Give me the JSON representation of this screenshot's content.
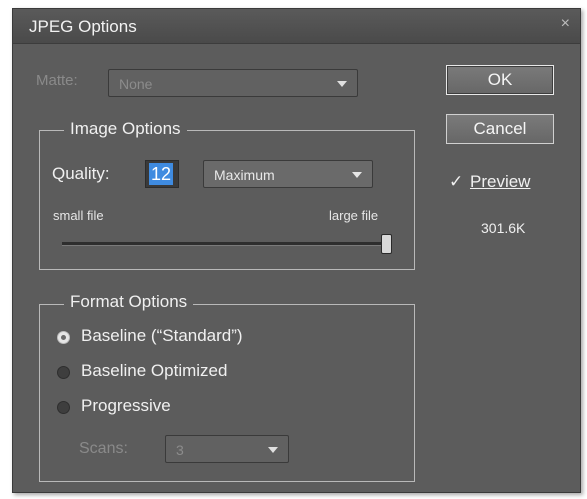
{
  "dialog": {
    "title": "JPEG Options",
    "close_glyph": "×"
  },
  "matte": {
    "label": "Matte:",
    "value": "None"
  },
  "image_options": {
    "group_title": "Image Options",
    "quality_label": "Quality:",
    "quality_value": "12",
    "quality_preset": "Maximum",
    "small_label": "small file",
    "large_label": "large file",
    "slider_fraction": 1.0
  },
  "format_options": {
    "group_title": "Format Options",
    "options": [
      {
        "label": "Baseline (“Standard”)",
        "checked": true
      },
      {
        "label": "Baseline Optimized",
        "checked": false
      },
      {
        "label": "Progressive",
        "checked": false
      }
    ],
    "scans_label": "Scans:",
    "scans_value": "3"
  },
  "buttons": {
    "ok": "OK",
    "cancel": "Cancel"
  },
  "preview": {
    "checkbox_glyph": "✓",
    "label": "Preview",
    "checked": true,
    "file_size": "301.6K"
  }
}
